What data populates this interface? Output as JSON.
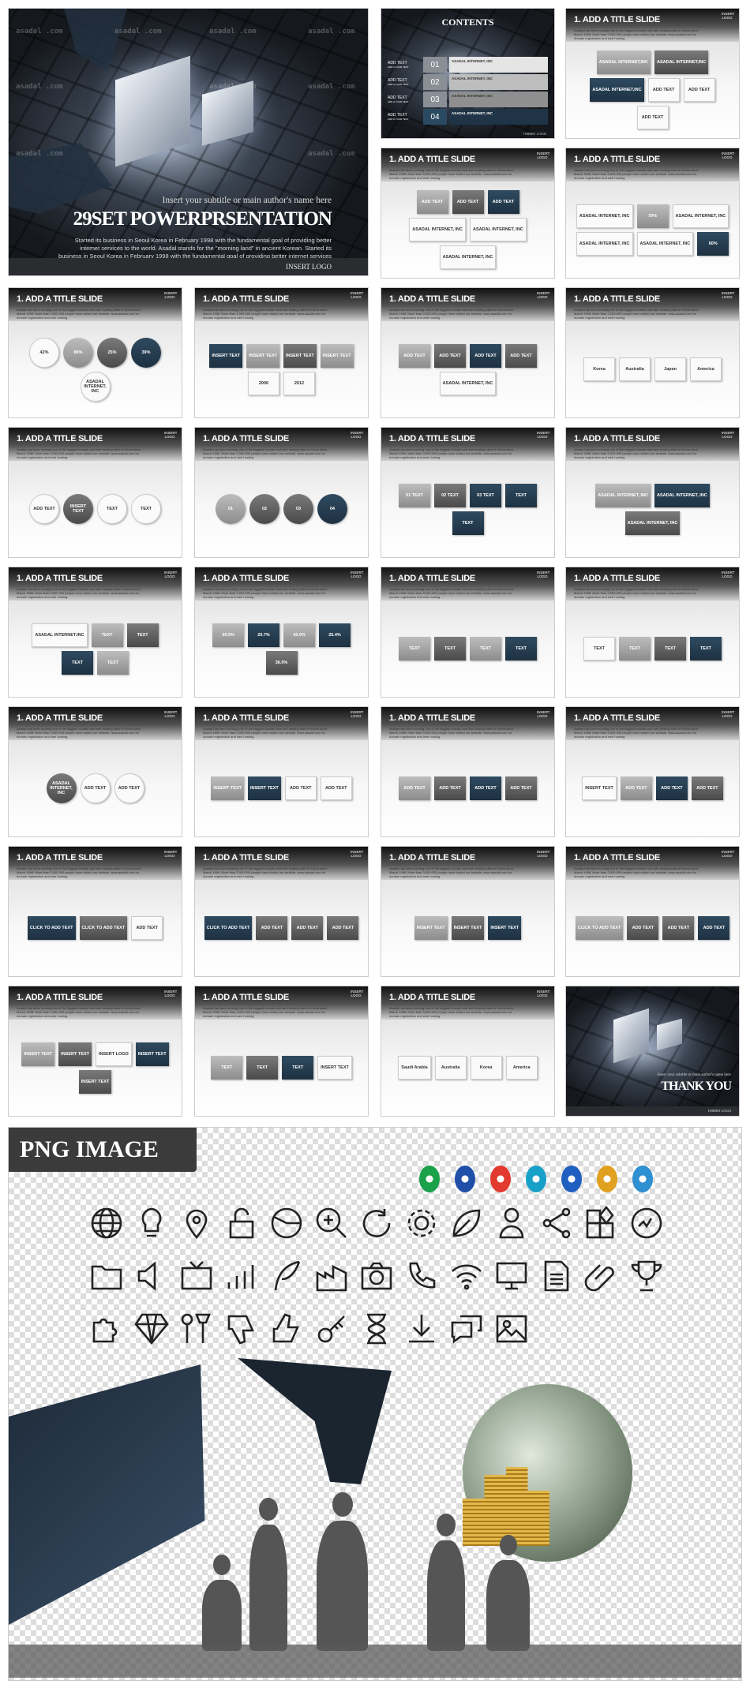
{
  "watermark": "asadal .com",
  "cover": {
    "subtitle": "Insert your subtitle or main author's name here",
    "title": "29SET POWERPRSENTATION",
    "body": "Started its business in Seoul Korea in February 1998 with the fundamental goal of providing better internet services to the world. Asadal stands for the \"morning land\" in ancient Korean. Started its business in Seoul Korea in February 1998 with the fundamental goal of providing better internet services to the world.",
    "logo": "INSERT LOGO"
  },
  "slide_common": {
    "title": "1. ADD A TITLE SLIDE",
    "desc": "Asadal has been running one of the biggest domain and web hosting sites in Korea since March 1998. More than 3,000,000 people have visited our website. www.asadal.com for domain registration and web hosting.",
    "logo": "INSERT LOGO"
  },
  "contents_slide": {
    "title": "CONTENTS",
    "logo": "INSERT LOGO",
    "items": [
      {
        "num": "01",
        "label": "ADD TEXT",
        "sub": "ADD A YOUR TEXT",
        "heading": "ASADAL INTERNET, INC"
      },
      {
        "num": "02",
        "label": "ADD TEXT",
        "sub": "ADD A YOUR TEXT",
        "heading": "ASADAL INTERNET, INC"
      },
      {
        "num": "03",
        "label": "ADD TEXT",
        "sub": "ADD A YOUR TEXT",
        "heading": "ASADAL INTERNET, INC"
      },
      {
        "num": "04",
        "label": "ADD TEXT",
        "sub": "ADD A YOUR TEXT",
        "heading": "ASADAL INTERNET, INC"
      }
    ]
  },
  "slides": [
    {
      "style": "row",
      "blocks": [
        [
          "ASADAL INTERNET,INC",
          "g1"
        ],
        [
          "ASADAL INTERNET,INC",
          "g2"
        ],
        [
          "ASADAL INTERNET,INC",
          "nv"
        ],
        [
          "ADD TEXT",
          "wt"
        ],
        [
          "ADD TEXT",
          "wt"
        ],
        [
          "ADD TEXT",
          "wt"
        ]
      ]
    },
    {
      "style": "row",
      "blocks": [
        [
          "ADD TEXT",
          "g1"
        ],
        [
          "ADD TEXT",
          "g2"
        ],
        [
          "ADD TEXT",
          "nv"
        ],
        [
          "ASADAL INTERNET, INC",
          "wt"
        ],
        [
          "ASADAL INTERNET, INC",
          "wt"
        ],
        [
          "ASADAL INTERNET, INC",
          "wt"
        ]
      ]
    },
    {
      "style": "row",
      "blocks": [
        [
          "ASADAL INTERNET, INC",
          "wt"
        ],
        [
          "79%",
          "g1"
        ],
        [
          "ASADAL INTERNET, INC",
          "wt"
        ],
        [
          "ASADAL INTERNET, INC",
          "wt"
        ],
        [
          "ASADAL INTERNET, INC",
          "wt"
        ],
        [
          "60%",
          "nv"
        ]
      ]
    },
    {
      "style": "round",
      "blocks": [
        [
          "42%",
          "wt"
        ],
        [
          "89%",
          "g1"
        ],
        [
          "25%",
          "g2"
        ],
        [
          "39%",
          "nv"
        ],
        [
          "ASADAL INTERNET, INC",
          "wt"
        ]
      ]
    },
    {
      "style": "row",
      "blocks": [
        [
          "INSERT TEXT",
          "nv"
        ],
        [
          "INSERT TEXT",
          "g1"
        ],
        [
          "INSERT TEXT",
          "g2"
        ],
        [
          "INSERT TEXT",
          "g1"
        ],
        [
          "2006",
          "wt"
        ],
        [
          "2012",
          "wt"
        ]
      ]
    },
    {
      "style": "row",
      "blocks": [
        [
          "ADD TEXT",
          "g1"
        ],
        [
          "ADD TEXT",
          "g2"
        ],
        [
          "ADD TEXT",
          "nv"
        ],
        [
          "ADD TEXT",
          "g2"
        ],
        [
          "ASADAL INTERNET, INC",
          "wt"
        ]
      ]
    },
    {
      "style": "row",
      "blocks": [
        [
          "Korea",
          "wt"
        ],
        [
          "Australia",
          "wt"
        ],
        [
          "Japan",
          "wt"
        ],
        [
          "America",
          "wt"
        ]
      ]
    },
    {
      "style": "round",
      "blocks": [
        [
          "ADD TEXT",
          "wt"
        ],
        [
          "INSERT TEXT",
          "g2"
        ],
        [
          "TEXT",
          "wt"
        ],
        [
          "TEXT",
          "wt"
        ]
      ]
    },
    {
      "style": "round",
      "blocks": [
        [
          "01",
          "g1"
        ],
        [
          "02",
          "g2"
        ],
        [
          "03",
          "g2"
        ],
        [
          "04",
          "nv"
        ]
      ]
    },
    {
      "style": "row",
      "blocks": [
        [
          "01 TEXT",
          "g1"
        ],
        [
          "02 TEXT",
          "g2"
        ],
        [
          "03 TEXT",
          "nv"
        ],
        [
          "TEXT",
          "nv"
        ],
        [
          "TEXT",
          "nv"
        ]
      ]
    },
    {
      "style": "row",
      "blocks": [
        [
          "ASADAL INTERNET, INC",
          "g1"
        ],
        [
          "ASADAL INTERNET, INC",
          "nv"
        ],
        [
          "ASADAL INTERNET, INC",
          "g2"
        ]
      ]
    },
    {
      "style": "row",
      "blocks": [
        [
          "ASADAL INTERNET.INC",
          "wt"
        ],
        [
          "TEXT",
          "g1"
        ],
        [
          "TEXT",
          "g2"
        ],
        [
          "TEXT",
          "nv"
        ],
        [
          "TEXT",
          "g1"
        ]
      ]
    },
    {
      "style": "row",
      "blocks": [
        [
          "39.5%",
          "g1"
        ],
        [
          "20.7%",
          "nv"
        ],
        [
          "42.0%",
          "g1"
        ],
        [
          "25.4%",
          "nv"
        ],
        [
          "36.0%",
          "g2"
        ]
      ]
    },
    {
      "style": "row",
      "blocks": [
        [
          "TEXT",
          "g1"
        ],
        [
          "TEXT",
          "g2"
        ],
        [
          "TEXT",
          "g1"
        ],
        [
          "TEXT",
          "nv"
        ]
      ]
    },
    {
      "style": "row",
      "blocks": [
        [
          "TEXT",
          "wt"
        ],
        [
          "TEXT",
          "g1"
        ],
        [
          "TEXT",
          "g2"
        ],
        [
          "TEXT",
          "nv"
        ]
      ]
    },
    {
      "style": "round",
      "blocks": [
        [
          "ASADAL INTERNET, INC",
          "g2"
        ],
        [
          "ADD TEXT",
          "wt"
        ],
        [
          "ADD TEXT",
          "wt"
        ]
      ]
    },
    {
      "style": "row",
      "blocks": [
        [
          "INSERT TEXT",
          "g1"
        ],
        [
          "INSERT TEXT",
          "nv"
        ],
        [
          "ADD TEXT",
          "wt"
        ],
        [
          "ADD TEXT",
          "wt"
        ]
      ]
    },
    {
      "style": "row",
      "blocks": [
        [
          "ADD TEXT",
          "g1"
        ],
        [
          "ADD TEXT",
          "g2"
        ],
        [
          "ADD TEXT",
          "nv"
        ],
        [
          "ADD TEXT",
          "g2"
        ]
      ]
    },
    {
      "style": "row",
      "blocks": [
        [
          "INSERT TEXT",
          "wt"
        ],
        [
          "ADD TEXT",
          "g1"
        ],
        [
          "ADD TEXT",
          "nv"
        ],
        [
          "ADD TEXT",
          "g2"
        ]
      ]
    },
    {
      "style": "row",
      "blocks": [
        [
          "CLICK TO ADD TEXT",
          "nv"
        ],
        [
          "CLICK TO ADD TEXT",
          "g2"
        ],
        [
          "ADD TEXT",
          "wt"
        ]
      ]
    },
    {
      "style": "row",
      "blocks": [
        [
          "CLICK TO ADD TEXT",
          "nv"
        ],
        [
          "ADD TEXT",
          "g2"
        ],
        [
          "ADD TEXT",
          "g2"
        ],
        [
          "ADD TEXT",
          "g2"
        ]
      ]
    },
    {
      "style": "row",
      "blocks": [
        [
          "INSERT TEXT",
          "g1"
        ],
        [
          "INSERT TEXT",
          "g2"
        ],
        [
          "INSERT TEXT",
          "nv"
        ]
      ]
    },
    {
      "style": "row",
      "blocks": [
        [
          "CLICK TO ADD TEXT",
          "g1"
        ],
        [
          "ADD TEXT",
          "g2"
        ],
        [
          "ADD TEXT",
          "g2"
        ],
        [
          "ADD TEXT",
          "nv"
        ]
      ]
    },
    {
      "style": "row",
      "blocks": [
        [
          "INSERT TEXT",
          "g1"
        ],
        [
          "INSERT TEXT",
          "g2"
        ],
        [
          "INSERT LOGO",
          "wt"
        ],
        [
          "INSERT TEXT",
          "nv"
        ],
        [
          "INSERT TEXT",
          "g2"
        ]
      ]
    },
    {
      "style": "row",
      "blocks": [
        [
          "TEXT",
          "g1"
        ],
        [
          "TEXT",
          "g2"
        ],
        [
          "TEXT",
          "nv"
        ],
        [
          "INSERT TEXT",
          "wt"
        ]
      ]
    },
    {
      "style": "row",
      "blocks": [
        [
          "Saudi Arabia",
          "wt"
        ],
        [
          "Australia",
          "wt"
        ],
        [
          "Korea",
          "wt"
        ],
        [
          "America",
          "wt"
        ]
      ]
    }
  ],
  "thankyou": {
    "subtitle": "Insert your subtitle or main author's name here",
    "title": "THANK YOU",
    "logo": "INSERT LOGO"
  },
  "png_section": {
    "label": "PNG IMAGE",
    "logo_colors": [
      "#1aa14a",
      "#1f4fa8",
      "#e23a2f",
      "#17a0c8",
      "#1f5fbf",
      "#e0a020",
      "#2e8fd1"
    ],
    "icons": [
      "globe",
      "lightbulb",
      "location-pin",
      "unlock",
      "pie-chart",
      "zoom-in",
      "refresh",
      "gear",
      "leaf",
      "person",
      "share",
      "blocks",
      "earth",
      "folder",
      "speaker",
      "tv",
      "bar-chart",
      "quill",
      "factory",
      "camera",
      "phone",
      "wifi",
      "monitor",
      "document",
      "paperclip",
      "trophy",
      "puzzle",
      "diamond",
      "tools",
      "thumbs-down",
      "thumbs-up",
      "key",
      "hourglass",
      "download",
      "chat",
      "image"
    ]
  },
  "colors": {
    "navy": "#1f3446",
    "dark": "#15181d",
    "gray": "#555555"
  }
}
